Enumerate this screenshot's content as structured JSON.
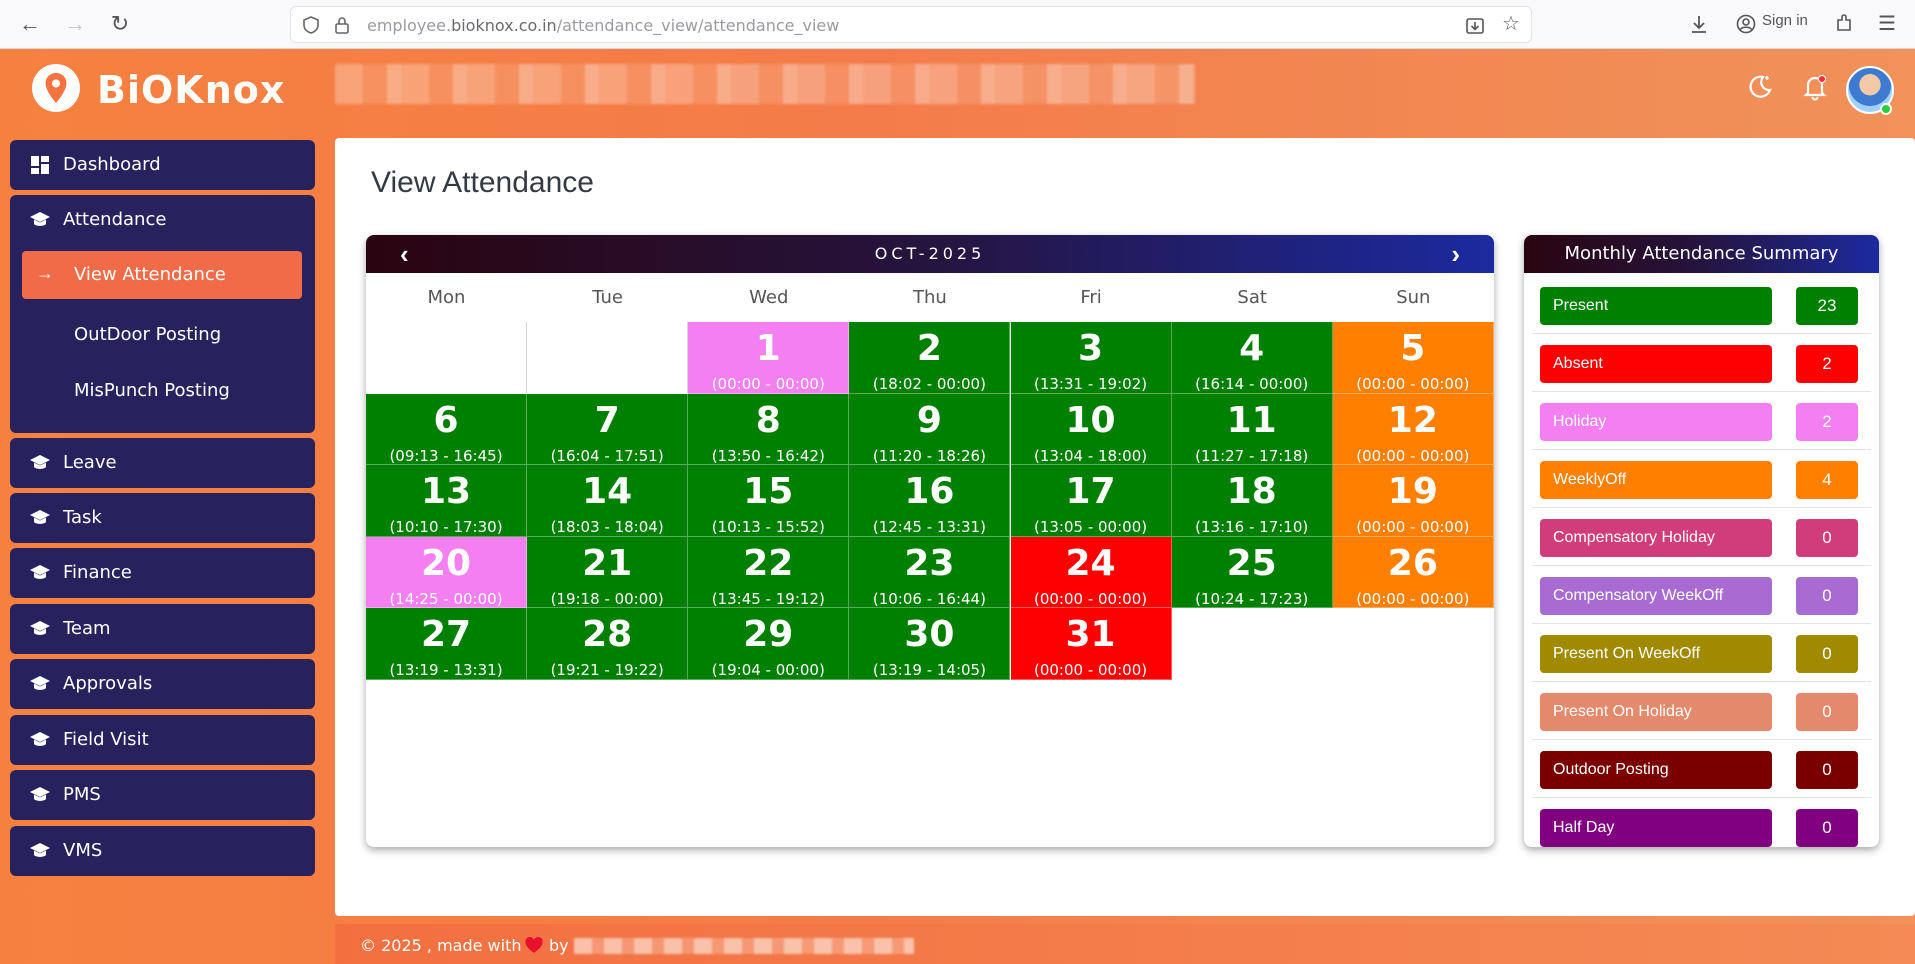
{
  "browser": {
    "url_prefix": "employee.",
    "url_domain": "bioknox.co.in",
    "url_path": "/attendance_view/attendance_view",
    "signin_label": "Sign in"
  },
  "app": {
    "logo_text": "BiOKnox"
  },
  "sidebar": {
    "dashboard": "Dashboard",
    "attendance": "Attendance",
    "view_attendance": "View Attendance",
    "outdoor_posting": "OutDoor Posting",
    "mispunch_posting": "MisPunch Posting",
    "leave": "Leave",
    "task": "Task",
    "finance": "Finance",
    "team": "Team",
    "approvals": "Approvals",
    "field_visit": "Field Visit",
    "pms": "PMS",
    "vms": "VMS"
  },
  "main": {
    "title": "View Attendance"
  },
  "calendar": {
    "month_label": "OCT-2025",
    "weekdays": [
      "Mon",
      "Tue",
      "Wed",
      "Thu",
      "Fri",
      "Sat",
      "Sun"
    ],
    "days": [
      {
        "day": "1",
        "time": "(00:00 - 00:00)",
        "status": "holiday"
      },
      {
        "day": "2",
        "time": "(18:02 - 00:00)",
        "status": "present"
      },
      {
        "day": "3",
        "time": "(13:31 - 19:02)",
        "status": "present"
      },
      {
        "day": "4",
        "time": "(16:14 - 00:00)",
        "status": "present"
      },
      {
        "day": "5",
        "time": "(00:00 - 00:00)",
        "status": "weeklyoff"
      },
      {
        "day": "6",
        "time": "(09:13 - 16:45)",
        "status": "present"
      },
      {
        "day": "7",
        "time": "(16:04 - 17:51)",
        "status": "present"
      },
      {
        "day": "8",
        "time": "(13:50 - 16:42)",
        "status": "present"
      },
      {
        "day": "9",
        "time": "(11:20 - 18:26)",
        "status": "present"
      },
      {
        "day": "10",
        "time": "(13:04 - 18:00)",
        "status": "present"
      },
      {
        "day": "11",
        "time": "(11:27 - 17:18)",
        "status": "present"
      },
      {
        "day": "12",
        "time": "(00:00 - 00:00)",
        "status": "weeklyoff"
      },
      {
        "day": "13",
        "time": "(10:10 - 17:30)",
        "status": "present"
      },
      {
        "day": "14",
        "time": "(18:03 - 18:04)",
        "status": "present"
      },
      {
        "day": "15",
        "time": "(10:13 - 15:52)",
        "status": "present"
      },
      {
        "day": "16",
        "time": "(12:45 - 13:31)",
        "status": "present"
      },
      {
        "day": "17",
        "time": "(13:05 - 00:00)",
        "status": "present"
      },
      {
        "day": "18",
        "time": "(13:16 - 17:10)",
        "status": "present"
      },
      {
        "day": "19",
        "time": "(00:00 - 00:00)",
        "status": "weeklyoff"
      },
      {
        "day": "20",
        "time": "(14:25 - 00:00)",
        "status": "holiday"
      },
      {
        "day": "21",
        "time": "(19:18 - 00:00)",
        "status": "present"
      },
      {
        "day": "22",
        "time": "(13:45 - 19:12)",
        "status": "present"
      },
      {
        "day": "23",
        "time": "(10:06 - 16:44)",
        "status": "present"
      },
      {
        "day": "24",
        "time": "(00:00 - 00:00)",
        "status": "absent"
      },
      {
        "day": "25",
        "time": "(10:24 - 17:23)",
        "status": "present"
      },
      {
        "day": "26",
        "time": "(00:00 - 00:00)",
        "status": "weeklyoff"
      },
      {
        "day": "27",
        "time": "(13:19 - 13:31)",
        "status": "present"
      },
      {
        "day": "28",
        "time": "(19:21 - 19:22)",
        "status": "present"
      },
      {
        "day": "29",
        "time": "(19:04 - 00:00)",
        "status": "present"
      },
      {
        "day": "30",
        "time": "(13:19 - 14:05)",
        "status": "present"
      },
      {
        "day": "31",
        "time": "(00:00 - 00:00)",
        "status": "absent"
      }
    ],
    "status_colors": {
      "present": "#008000",
      "absent": "#ff0000",
      "holiday": "#f47ff0",
      "weeklyoff": "#ff8000"
    }
  },
  "summary": {
    "title": "Monthly Attendance Summary",
    "rows": [
      {
        "label": "Present",
        "value": "23",
        "color": "#008000"
      },
      {
        "label": "Absent",
        "value": "2",
        "color": "#ff0000"
      },
      {
        "label": "Holiday",
        "value": "2",
        "color": "#f47ff0"
      },
      {
        "label": "WeeklyOff",
        "value": "4",
        "color": "#ff8000"
      },
      {
        "label": "Compensatory Holiday",
        "value": "0",
        "color": "#d13d7a"
      },
      {
        "label": "Compensatory WeekOff",
        "value": "0",
        "color": "#a86bd1"
      },
      {
        "label": "Present On WeekOff",
        "value": "0",
        "color": "#a08a00"
      },
      {
        "label": "Present On Holiday",
        "value": "0",
        "color": "#e48a6c"
      },
      {
        "label": "Outdoor Posting",
        "value": "0",
        "color": "#7a0000"
      },
      {
        "label": "Half Day",
        "value": "0",
        "color": "#800080"
      }
    ]
  },
  "footer": {
    "text": "© 2025 , made with",
    "by": "by"
  }
}
